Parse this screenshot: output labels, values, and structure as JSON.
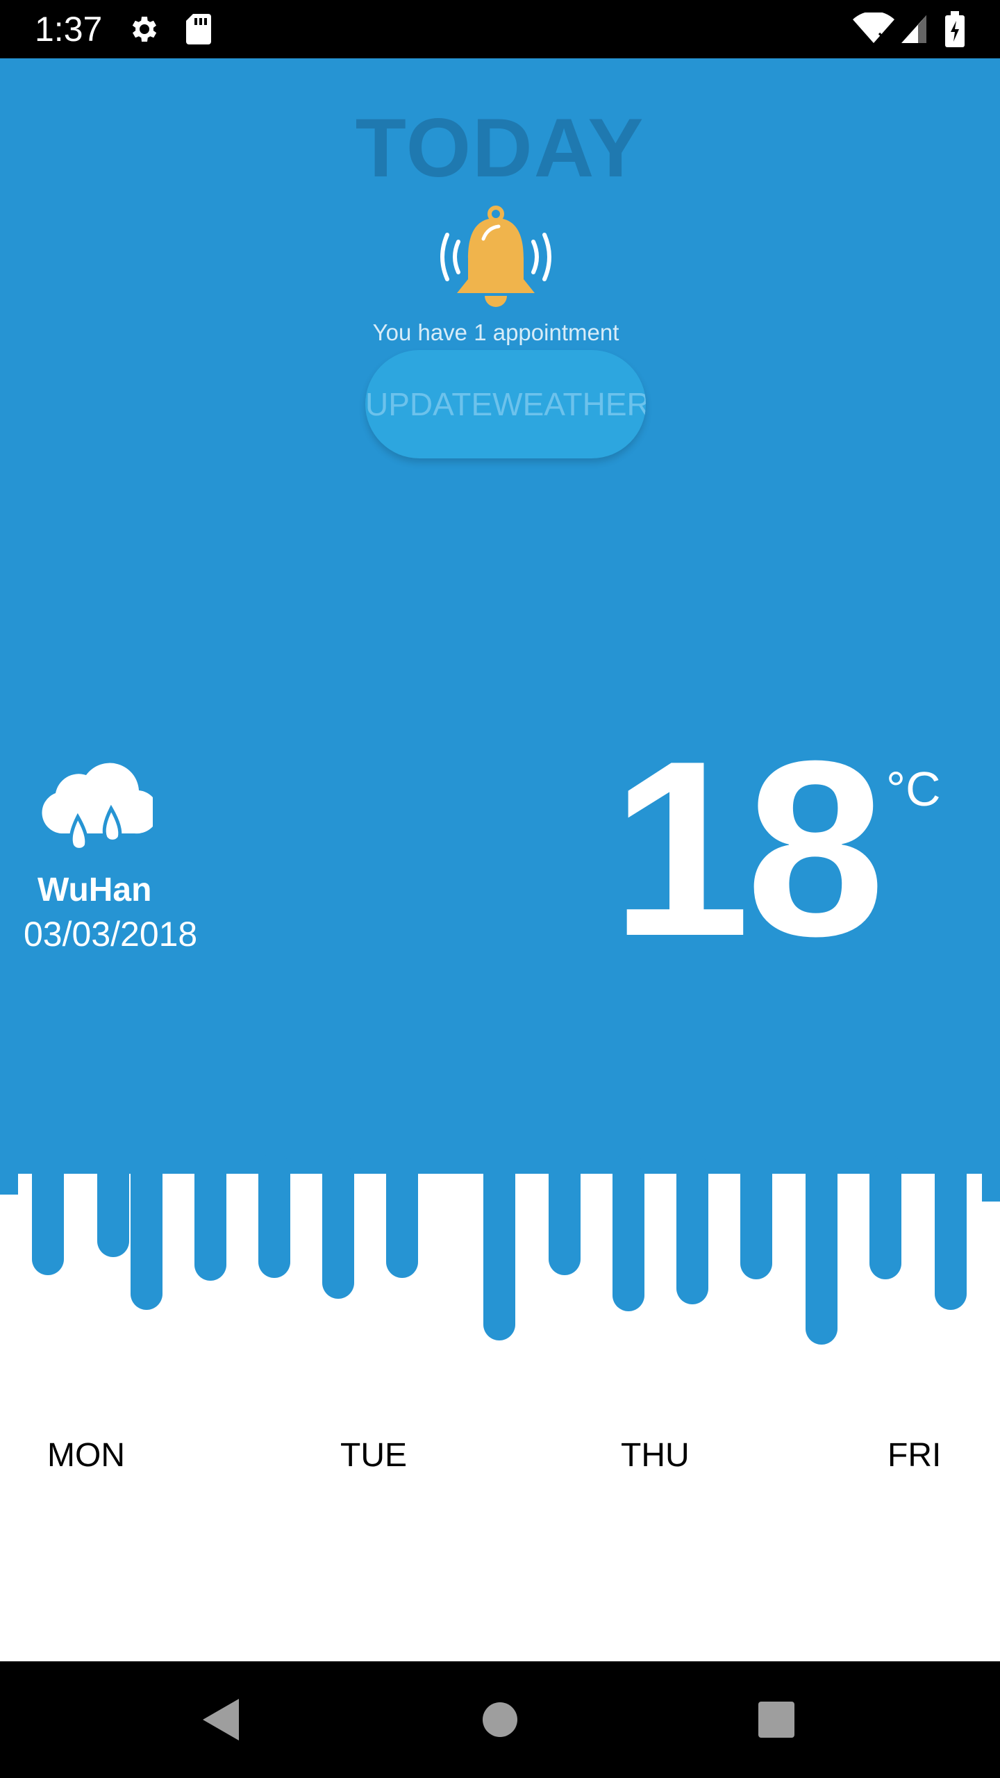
{
  "status_bar": {
    "time": "1:37",
    "icons": [
      "gear-icon",
      "sdcard-icon",
      "wifi-icon",
      "signal-icon",
      "battery-charging-icon"
    ]
  },
  "header": {
    "title": "TODAY",
    "appointment_text": "You have 1 appointment",
    "update_button_label": "UPDATEWEATHER"
  },
  "weather": {
    "icon": "rain-cloud-icon",
    "city": "WuHan",
    "date": "03/03/2018",
    "temperature": "18",
    "unit": "°C"
  },
  "forecast": {
    "days": [
      "MON",
      "TUE",
      "THU",
      "FRI"
    ]
  },
  "nav_bar": {
    "icons": [
      "back-icon",
      "home-icon",
      "recents-icon"
    ]
  },
  "colors": {
    "primary_blue": "#2694d3",
    "title_dark_blue": "#1f79b0",
    "button_blue": "#2da6df",
    "bell_orange": "#f0b44c"
  }
}
